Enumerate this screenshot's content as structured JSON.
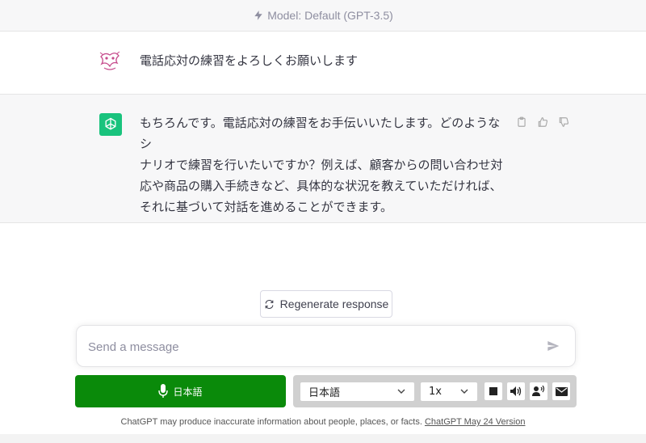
{
  "header": {
    "model_label": "Model: Default (GPT-3.5)"
  },
  "conversation": {
    "user_message": "電話応対の練習をよろしくお願いします",
    "assistant_lines": [
      "もちろんです。電話応対の練習をお手伝いいたします。どのようなシ",
      "ナリオで練習を行いたいですか？例えば、顧客からの問い合わせ対",
      "応や商品の購入手続きなど、具体的な状況を教えていただければ、",
      "それに基づいて対話を進めることができます。"
    ]
  },
  "regenerate": {
    "label": "Regenerate response"
  },
  "composer": {
    "placeholder": "Send a message",
    "value": ""
  },
  "voice": {
    "mic_label": "日本語"
  },
  "tts": {
    "language": "日本語",
    "speed": "1x",
    "buttons": [
      "stop-icon",
      "speaker-icon",
      "voice-person-icon",
      "mail-icon"
    ]
  },
  "footer": {
    "disclaimer": "ChatGPT may produce inaccurate information about people, places, or facts.",
    "version_link": "ChatGPT May 24 Version"
  },
  "colors": {
    "accent_green": "#19c37d",
    "mic_green": "#0a8a0a",
    "background_gray": "#f7f7f8"
  }
}
